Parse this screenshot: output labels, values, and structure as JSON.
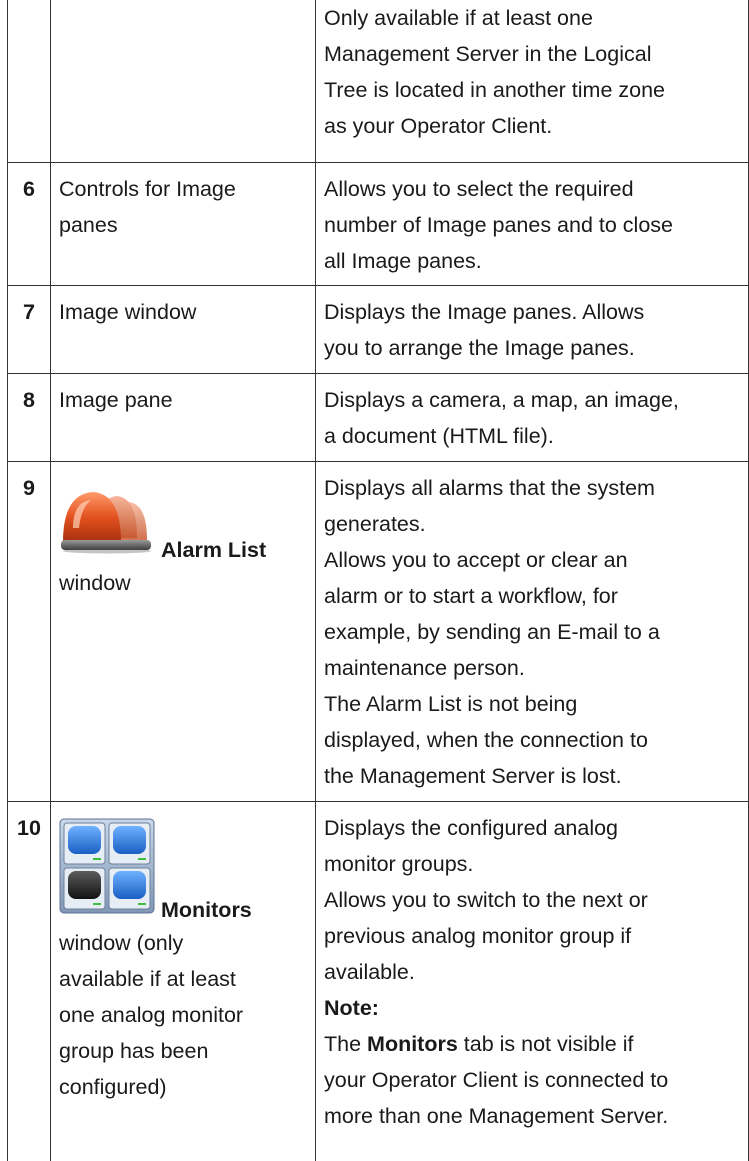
{
  "rows": [
    {
      "number": "",
      "element_lines": [],
      "description_lines": [
        "Only available if at least one",
        "Management Server in the Logical",
        "Tree is located in another time zone",
        "as your Operator Client."
      ]
    },
    {
      "number": "6",
      "element_lines": [
        "Controls for Image",
        "panes"
      ],
      "description_lines": [
        "Allows you to select the required",
        "number of Image panes and to close",
        "all Image panes."
      ]
    },
    {
      "number": "7",
      "element_lines": [
        "Image window"
      ],
      "description_lines": [
        "Displays the Image panes. Allows",
        "you to arrange the Image panes."
      ]
    },
    {
      "number": "8",
      "element_lines": [
        "Image pane"
      ],
      "description_lines": [
        "Displays a camera, a map, an image,",
        "a document (HTML file)."
      ]
    },
    {
      "number": "9",
      "element_bold": "Alarm List",
      "element_lines": [
        "window"
      ],
      "icon": "alarm-beacon-icon",
      "description_lines": [
        "Displays all alarms that the system",
        "generates.",
        "Allows you to accept or clear an",
        "alarm or to start a workflow, for",
        "example, by sending an E-mail to a",
        "maintenance person.",
        "The Alarm List is not being",
        "displayed, when the connection to",
        "the Management Server is lost."
      ]
    },
    {
      "number": "10",
      "element_bold": "Monitors",
      "element_lines": [
        "window (only",
        "available if at least",
        "one analog monitor",
        "group has been",
        "configured)"
      ],
      "icon": "monitors-grid-icon",
      "description_lines": [
        "Displays the configured analog",
        "monitor groups.",
        "Allows you to switch to the next or",
        "previous analog monitor group if",
        "available."
      ],
      "note_label": "Note:",
      "note_pre": "The ",
      "note_bold": "Monitors",
      "note_post_lines": [
        " tab is not visible if",
        "your Operator Client is connected to",
        "more than one Management Server."
      ]
    }
  ],
  "colors": {
    "alarm_red": "#d9481c",
    "monitor_blue": "#1e6fd0",
    "monitor_frame": "#8aa6c4"
  }
}
